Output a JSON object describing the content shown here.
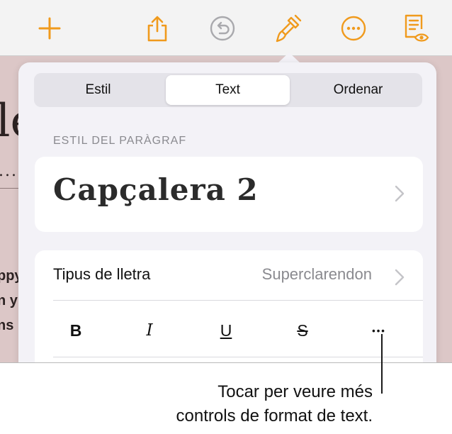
{
  "toolbar": {
    "icons": [
      "add-icon",
      "share-icon",
      "undo-icon",
      "format-paintbrush-icon",
      "more-icon",
      "reading-view-icon"
    ],
    "accent": "#f09a1c"
  },
  "document": {
    "fragment_large": "le",
    "fragment_dots": "...",
    "fragment_lines": [
      "ppy",
      "n y",
      "ns"
    ]
  },
  "popover": {
    "tabs": [
      {
        "label": "Estil",
        "selected": false
      },
      {
        "label": "Text",
        "selected": true
      },
      {
        "label": "Ordenar",
        "selected": false
      }
    ],
    "paragraph_style": {
      "section_label": "ESTIL DEL PARÀGRAF",
      "value": "Capçalera 2"
    },
    "font": {
      "label": "Tipus de lletra",
      "value": "Superclarendon"
    },
    "format_buttons": {
      "bold": "B",
      "italic": "I",
      "underline": "U",
      "strikethrough": "S",
      "more": "•••"
    }
  },
  "callout": {
    "lines": [
      "Tocar per veure més",
      "controls de format de text."
    ]
  }
}
